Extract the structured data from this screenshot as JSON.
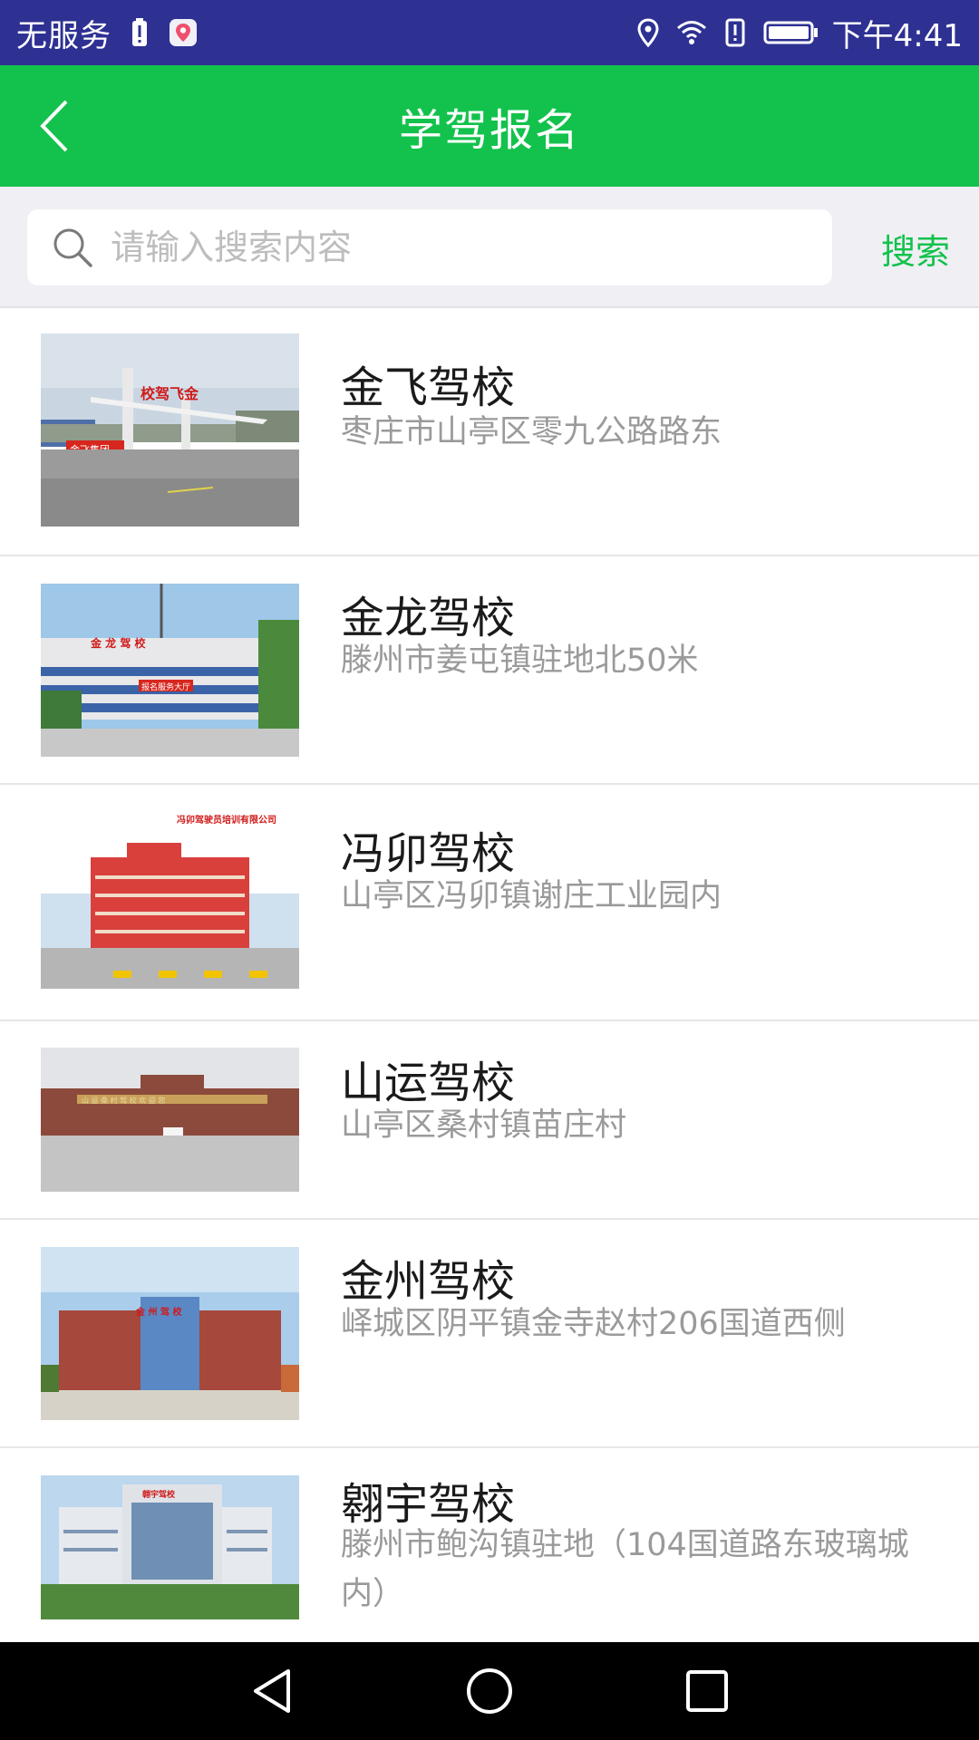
{
  "status_bar": {
    "carrier": "无服务",
    "time": "下午4:41"
  },
  "header": {
    "title": "学驾报名"
  },
  "search": {
    "placeholder": "请输入搜索内容",
    "value": "",
    "button_label": "搜索"
  },
  "schools": [
    {
      "name": "金飞驾校",
      "address": "枣庄市山亭区零九公路路东"
    },
    {
      "name": "金龙驾校",
      "address": "滕州市姜屯镇驻地北50米"
    },
    {
      "name": "冯卯驾校",
      "address": "山亭区冯卯镇谢庄工业园内"
    },
    {
      "name": "山运驾校",
      "address": "山亭区桑村镇苗庄村"
    },
    {
      "name": "金州驾校",
      "address": "峄城区阴平镇金寺赵村206国道西侧"
    },
    {
      "name": "翱宇驾校",
      "address": "滕州市鲍沟镇驻地（104国道路东玻璃城内）"
    }
  ],
  "photo_signs": {
    "school_0": "校驾飞金",
    "school_0_group": "金飞集团",
    "school_1": "金 龙 驾 校",
    "school_1_hall": "报名服务大厅",
    "school_2": "冯卯驾驶员培训有限公司",
    "school_3": "山 运 桑 村 驾 校 欢 迎 您",
    "school_4": "金 州 驾 校",
    "school_5": "翱宇驾校"
  },
  "colors": {
    "status_bar": "#2e3192",
    "header": "#13c24c",
    "accent": "#13c24c",
    "search_bg": "#efeff4",
    "nav_bar": "#000000"
  }
}
